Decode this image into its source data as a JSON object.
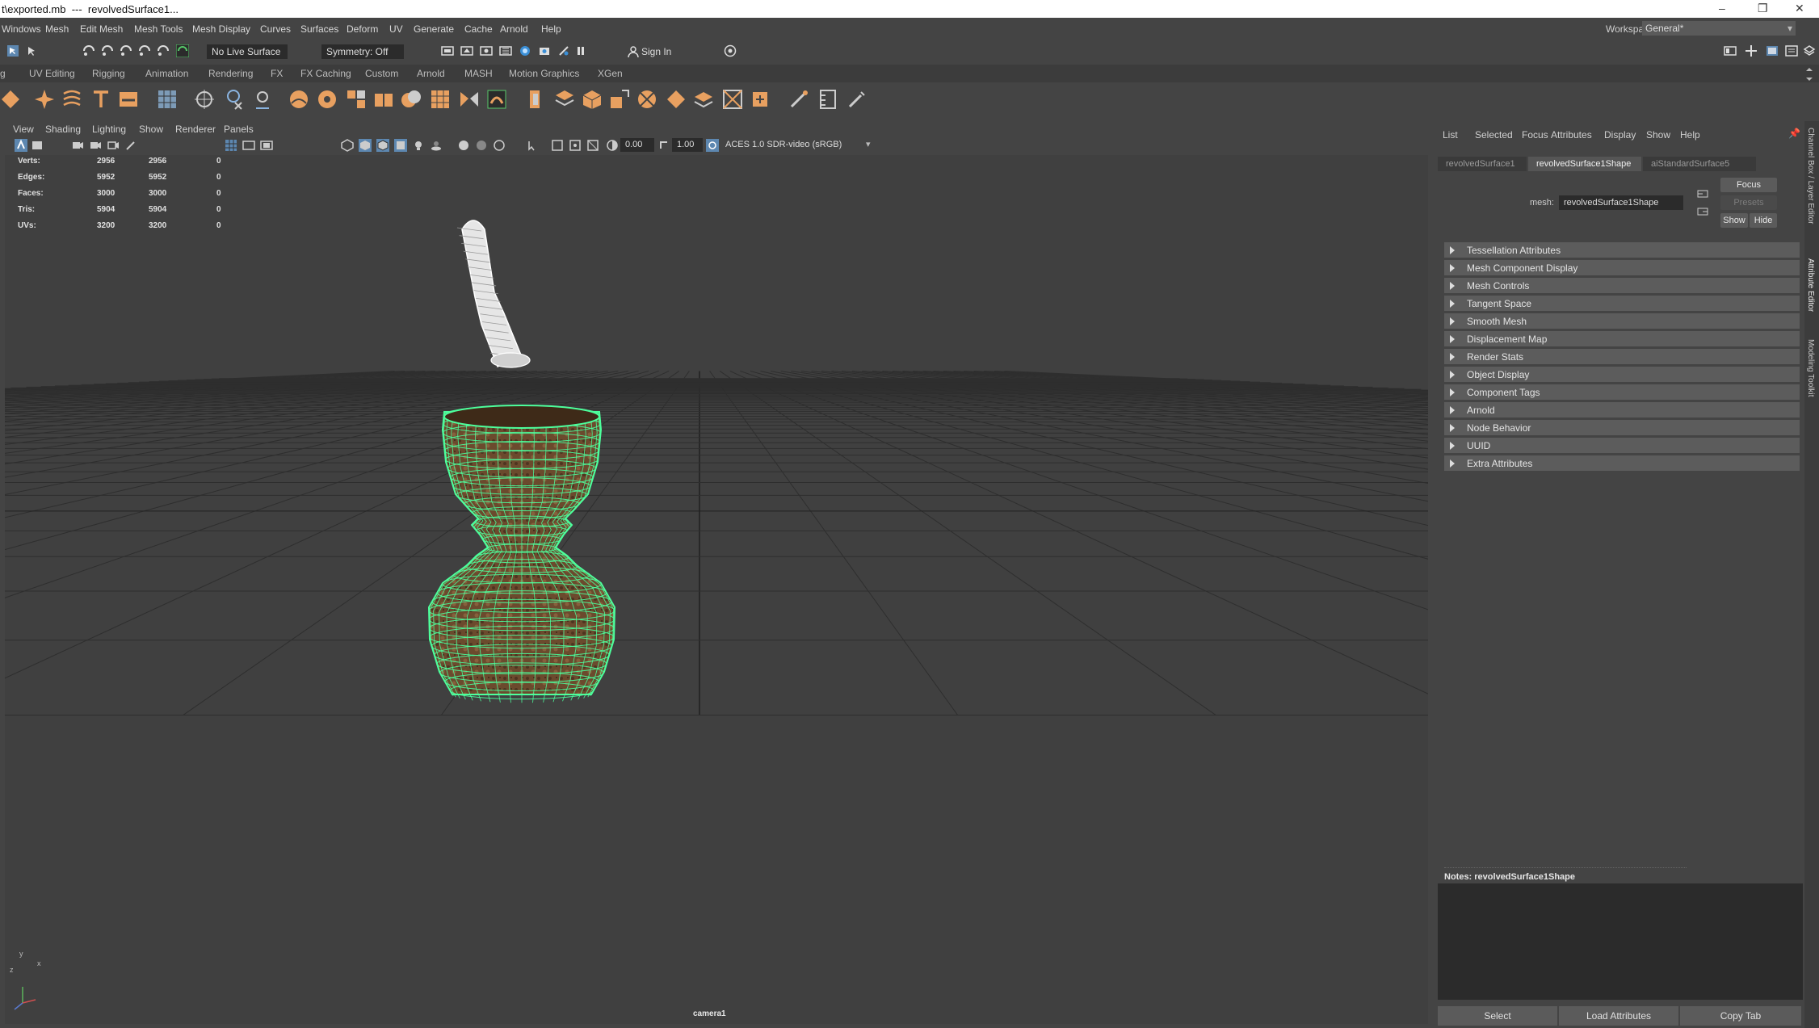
{
  "window": {
    "title": "t\\exported.mb  ---  revolvedSurface1..."
  },
  "menubar": {
    "items": [
      "Windows",
      "Mesh",
      "Edit Mesh",
      "Mesh Tools",
      "Mesh Display",
      "Curves",
      "Surfaces",
      "Deform",
      "UV",
      "Generate",
      "Cache",
      "Arnold",
      "Help"
    ],
    "workspace_label": "Workspace:",
    "workspace_value": "General*"
  },
  "statusline": {
    "live_surface": "No Live Surface",
    "symmetry": "Symmetry: Off",
    "sign_in": "Sign In"
  },
  "shelf_tabs": [
    "g",
    "UV Editing",
    "Rigging",
    "Animation",
    "Rendering",
    "FX",
    "FX Caching",
    "Custom",
    "Arnold",
    "MASH",
    "Motion Graphics",
    "XGen"
  ],
  "viewport": {
    "menu": [
      "View",
      "Shading",
      "Lighting",
      "Show",
      "Renderer",
      "Panels"
    ],
    "exposure": "0.00",
    "gamma": "1.00",
    "color_space": "ACES 1.0 SDR-video (sRGB)",
    "camera": "camera1",
    "hud": [
      {
        "label": "Verts:",
        "a": "2956",
        "b": "2956",
        "c": "0"
      },
      {
        "label": "Edges:",
        "a": "5952",
        "b": "5952",
        "c": "0"
      },
      {
        "label": "Faces:",
        "a": "3000",
        "b": "3000",
        "c": "0"
      },
      {
        "label": "Tris:",
        "a": "5904",
        "b": "5904",
        "c": "0"
      },
      {
        "label": "UVs:",
        "a": "3200",
        "b": "3200",
        "c": "0"
      }
    ],
    "axis": {
      "x": "x",
      "y": "y",
      "z": "z"
    }
  },
  "attribute_editor": {
    "menu": [
      "List",
      "Selected",
      "Focus",
      "Attributes",
      "Display",
      "Show",
      "Help"
    ],
    "tabs": [
      "revolvedSurface1",
      "revolvedSurface1Shape",
      "aiStandardSurface5"
    ],
    "mesh_label": "mesh:",
    "mesh_value": "revolvedSurface1Shape",
    "focus_btn": "Focus",
    "presets_btn": "Presets",
    "show_btn": "Show",
    "hide_btn": "Hide",
    "sections": [
      "Tessellation Attributes",
      "Mesh Component Display",
      "Mesh Controls",
      "Tangent Space",
      "Smooth Mesh",
      "Displacement Map",
      "Render Stats",
      "Object Display",
      "Component Tags",
      "Arnold",
      "Node Behavior",
      "UUID",
      "Extra Attributes"
    ],
    "notes_label": "Notes:  revolvedSurface1Shape",
    "bottom": [
      "Select",
      "Load Attributes",
      "Copy Tab"
    ]
  },
  "side_tabs": [
    "Channel Box / Layer Editor",
    "Attribute Editor",
    "Modeling Toolkit"
  ],
  "colors": {
    "wire": "#4dff9c",
    "shelf_orange": "#e8a060",
    "panel": "#444444",
    "grid": "#2e2e2e"
  }
}
